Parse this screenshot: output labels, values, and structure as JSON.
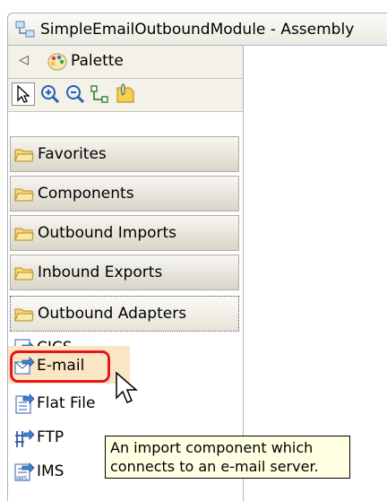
{
  "window": {
    "title": "SimpleEmailOutboundModule - Assembly"
  },
  "palette": {
    "label": "Palette"
  },
  "toolbar": {
    "tools": [
      "select-arrow-icon",
      "zoom-in-icon",
      "zoom-out-icon",
      "wire-connect-icon",
      "note-icon"
    ]
  },
  "drawers": [
    {
      "label": "Favorites"
    },
    {
      "label": "Components"
    },
    {
      "label": "Outbound Imports"
    },
    {
      "label": "Inbound Exports"
    },
    {
      "label": "Outbound Adapters"
    }
  ],
  "entries": [
    {
      "label": "CICS",
      "icon": "cics-adapter-icon"
    },
    {
      "label": "E-mail",
      "icon": "email-adapter-icon"
    },
    {
      "label": "Flat File",
      "icon": "flat-file-adapter-icon"
    },
    {
      "label": "FTP",
      "icon": "ftp-adapter-icon"
    },
    {
      "label": "IMS",
      "icon": "ims-adapter-icon"
    }
  ],
  "tooltip": {
    "line1": "An import component which",
    "line2": "connects to an e-mail server."
  },
  "colors": {
    "highlight": "#e8141c",
    "tooltip_bg": "#ffffe1",
    "selected_bg": "#fbe6c3"
  }
}
